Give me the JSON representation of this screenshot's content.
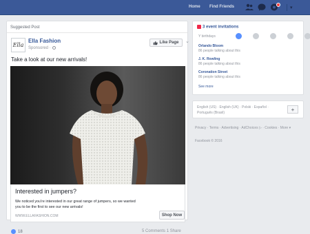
{
  "topbar": {
    "home": "Home",
    "find_friends": "Find Friends"
  },
  "post": {
    "suggested_label": "Suggested Post",
    "logo_text": "Ella",
    "page_name": "Ella Fashion",
    "sponsored": "Sponsored",
    "like_page": "Like Page",
    "text": "Take a look at our new arrivals!",
    "attachment": {
      "title": "Interested in jumpers?",
      "description": "We noticed you're interested in our great range of jumpers, so we wanted you to be the first to see our new arrivals!",
      "url": "WWW.ELLAFASHION.COM",
      "button": "Shop Now"
    },
    "like_count": "18",
    "comments": "5 Comments",
    "shares": "1 Share"
  },
  "sidebar": {
    "events_title": "3 event invitations",
    "events_sub": "Y birthdays",
    "events": [
      {
        "name": "Orlando Bloom",
        "desc": "86 people talking about this"
      },
      {
        "name": "J. K. Rowling",
        "desc": "86 people talking about this"
      },
      {
        "name": "Coronation Street",
        "desc": "86 people talking about this"
      }
    ],
    "see_more": "See more",
    "languages": "English (US) · English (UK) · Polski · Español · Português (Brasil)",
    "footer_links": "Privacy · Terms · Advertising · AdChoices ▷ · Cookies · More ▾",
    "copyright": "Facebook © 2016"
  },
  "colors": {
    "brand_blue": "#3b5998",
    "link_blue": "#365899",
    "background": "#e9ebee"
  }
}
